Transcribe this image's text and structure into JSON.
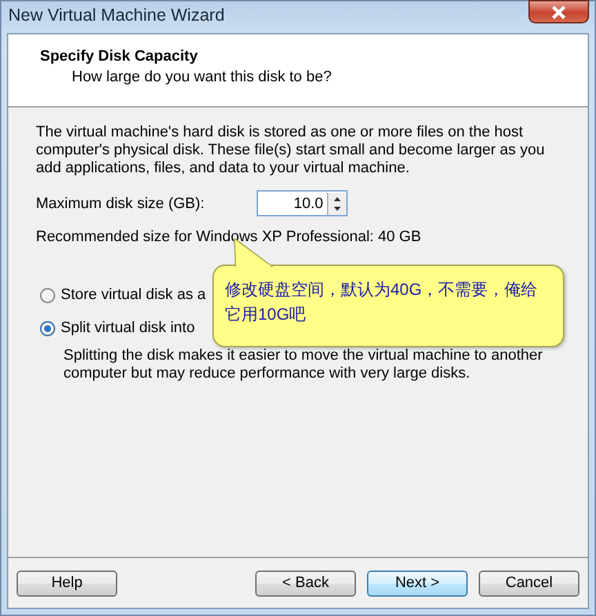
{
  "window": {
    "title": "New Virtual Machine Wizard"
  },
  "header": {
    "title": "Specify Disk Capacity",
    "subtitle": "How large do you want this disk to be?"
  },
  "description": "The virtual machine's hard disk is stored as one or more files on the host computer's physical disk. These file(s) start small and become larger as you add applications, files, and data to your virtual machine.",
  "disk_size": {
    "label": "Maximum disk size (GB):",
    "value": "10.0"
  },
  "recommended": "Recommended size for Windows XP Professional: 40 GB",
  "options": [
    {
      "label": "Store virtual disk as a",
      "selected": false
    },
    {
      "label": "Split virtual disk into",
      "selected": true
    }
  ],
  "split_note": "Splitting the disk makes it easier to move the virtual machine to another computer but may reduce performance with very large disks.",
  "callout": "修改硬盘空间，默认为40G，不需要，俺给它用10G吧",
  "buttons": [
    {
      "label": "Help",
      "kind": "normal"
    },
    {
      "label": "< Back",
      "kind": "normal"
    },
    {
      "label": "Next >",
      "kind": "default"
    },
    {
      "label": "Cancel",
      "kind": "normal"
    }
  ]
}
